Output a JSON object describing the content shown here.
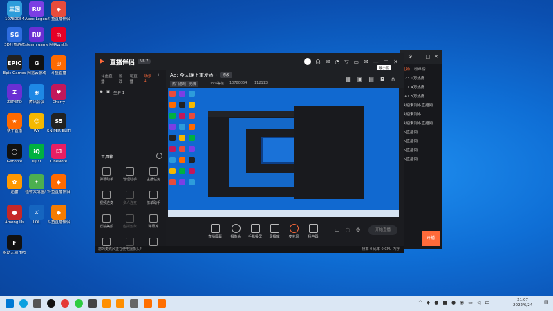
{
  "desktop_icons": [
    {
      "label": "10780054",
      "color": "#2d9cdb",
      "glyph": "三国"
    },
    {
      "label": "Apex Legends",
      "color": "#7b3fe4",
      "glyph": "RU"
    },
    {
      "label": "斗鱼直播伴侣",
      "color": "#e74c3c",
      "glyph": "◆"
    },
    {
      "label": "3D打鱼游戏",
      "color": "#2d6cdf",
      "glyph": "SG"
    },
    {
      "label": "steam game",
      "color": "#6a2fd3",
      "glyph": "RU"
    },
    {
      "label": "网易云音乐",
      "color": "#e60026",
      "glyph": "◎"
    },
    {
      "label": "Epic Games",
      "color": "#222222",
      "glyph": "EPIC"
    },
    {
      "label": "网易云游戏",
      "color": "#111111",
      "glyph": "G"
    },
    {
      "label": "斗鱼直播",
      "color": "#ff6a00",
      "glyph": "◎"
    },
    {
      "label": "ZEPETO",
      "color": "#6a2fd3",
      "glyph": "Z"
    },
    {
      "label": "腾讯会议",
      "color": "#1e88e5",
      "glyph": "◉"
    },
    {
      "label": "Cherry",
      "color": "#c2185b",
      "glyph": "♥"
    },
    {
      "label": "快手直播",
      "color": "#ff6a00",
      "glyph": "★"
    },
    {
      "label": "WY",
      "color": "#f5b800",
      "glyph": "☺"
    },
    {
      "label": "SNIPER ELITE 5",
      "color": "#222222",
      "glyph": "S5"
    },
    {
      "label": "GeForce",
      "color": "#111111",
      "glyph": "◯"
    },
    {
      "label": "iQIYI",
      "color": "#00b140",
      "glyph": "iQ"
    },
    {
      "label": "OneNote",
      "color": "#e91e63",
      "glyph": "印"
    },
    {
      "label": "迅雷",
      "color": "#ff9800",
      "glyph": "✿"
    },
    {
      "label": "植物大战僵尸",
      "color": "#4caf50",
      "glyph": "✦"
    },
    {
      "label": "斗鱼直播伴侣",
      "color": "#ff6a00",
      "glyph": "◆"
    },
    {
      "label": "Among Us",
      "color": "#c62828",
      "glyph": "●"
    },
    {
      "label": "LOL",
      "color": "#1565c0",
      "glyph": "⚔"
    },
    {
      "label": "斗鱼直播伴侣",
      "color": "#f57c00",
      "glyph": "◆"
    },
    {
      "label": "永劫无间 TPS",
      "color": "#111111",
      "glyph": "F"
    }
  ],
  "back_window": {
    "tabs": [
      "礼物",
      "粉丝榜"
    ],
    "rows": [
      "523.0万热度",
      "211.4万热度",
      "141.5万热度",
      "欢迎来到本直播间",
      "欢迎来到本",
      "欢迎来到本直播间",
      "本直播间",
      "本直播间",
      "本直播间",
      "本直播间"
    ],
    "button": "开播"
  },
  "main_window": {
    "brand": "直播伴侣",
    "version": "V6.7",
    "tooltip": "最小化",
    "left_tabs": [
      "斗鱼直播",
      "游戏",
      "可直播",
      "场景1"
    ],
    "scene": "全屏 1",
    "toolbox_title": "工具箱",
    "tools": [
      {
        "label": "弹幕助手",
        "dim": false
      },
      {
        "label": "管理助手",
        "dim": false
      },
      {
        "label": "主播任务",
        "dim": false
      },
      {
        "label": "视频连麦",
        "dim": false
      },
      {
        "label": "多人连麦",
        "dim": true
      },
      {
        "label": "榜单助手",
        "dim": false
      },
      {
        "label": "滤镜美颜",
        "dim": false
      },
      {
        "label": "虚拟形象",
        "dim": true
      },
      {
        "label": "弹幕库",
        "dim": false
      },
      {
        "label": "互动",
        "dim": false
      },
      {
        "label": "更多",
        "dim": true
      },
      {
        "label": "礼物",
        "dim": false
      }
    ],
    "stream_title": "Ap: 今天晚上重发表~~",
    "edit_label": "修改",
    "category": "热门游戏 · 无畏",
    "room_label": "Dota等级",
    "room_id": "10780054",
    "fans_count": "112113",
    "bottom_buttons": [
      "直播屏幕",
      "摄像头",
      "手机投屏",
      "录播库",
      "麦克风",
      "扬声器"
    ],
    "start_button": "开始直播",
    "status_text": "您的麦克风正在使用摄像头?",
    "status_right": "帧率 0  码率 0  CPU  内存"
  },
  "taskbar": {
    "time": "21:07",
    "date": "2022/6/24"
  }
}
